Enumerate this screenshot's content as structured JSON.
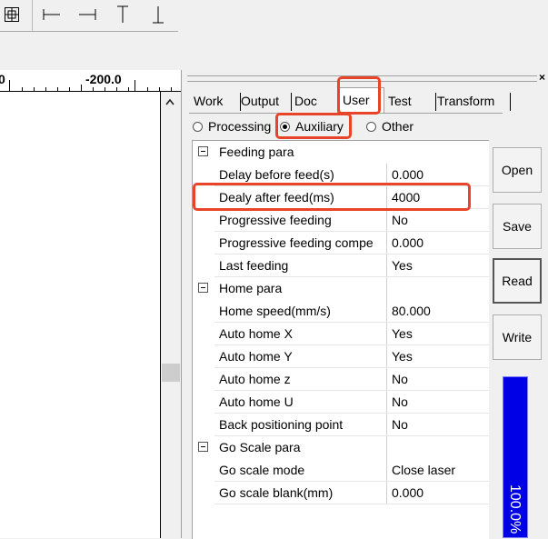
{
  "colors": {
    "highlight": "#e8442a",
    "gauge": "#0000e6",
    "window_bg": "#f0f0f0"
  },
  "toolbar": {
    "items": [
      {
        "icon": "grid-align-icon"
      },
      {
        "icon": "align-left-icon"
      },
      {
        "icon": "align-right-icon"
      },
      {
        "icon": "align-top-icon"
      },
      {
        "icon": "align-bottom-icon"
      }
    ]
  },
  "ruler": {
    "left_label": "0",
    "mid_label": "-200.0"
  },
  "tabs": [
    {
      "label": "Work"
    },
    {
      "label": "Output"
    },
    {
      "label": "Doc"
    },
    {
      "label": "User",
      "active": true
    },
    {
      "label": "Test"
    },
    {
      "label": "Transform"
    }
  ],
  "radios": [
    {
      "label": "Processing",
      "checked": false
    },
    {
      "label": "Auxiliary",
      "checked": true
    },
    {
      "label": "Other",
      "checked": false
    }
  ],
  "grid": {
    "rows": [
      {
        "type": "category",
        "name": "Feeding para",
        "value": ""
      },
      {
        "type": "item",
        "name": "Delay before feed(s)",
        "value": "0.000"
      },
      {
        "type": "item",
        "name": "Dealy after feed(ms)",
        "value": "4000"
      },
      {
        "type": "item",
        "name": "Progressive feeding",
        "value": "No"
      },
      {
        "type": "item",
        "name": "Progressive feeding compe",
        "value": "0.000"
      },
      {
        "type": "item",
        "name": "Last feeding",
        "value": "Yes"
      },
      {
        "type": "category",
        "name": "Home para",
        "value": ""
      },
      {
        "type": "item",
        "name": "Home speed(mm/s)",
        "value": "80.000"
      },
      {
        "type": "item",
        "name": "Auto home X",
        "value": "Yes"
      },
      {
        "type": "item",
        "name": "Auto home Y",
        "value": "Yes"
      },
      {
        "type": "item",
        "name": "Auto home z",
        "value": "No"
      },
      {
        "type": "item",
        "name": "Auto home U",
        "value": "No"
      },
      {
        "type": "item",
        "name": "Back positioning point",
        "value": "No"
      },
      {
        "type": "category",
        "name": "Go Scale para",
        "value": ""
      },
      {
        "type": "item",
        "name": "Go scale mode",
        "value": "Close laser"
      },
      {
        "type": "item",
        "name": "Go scale blank(mm)",
        "value": "0.000"
      }
    ]
  },
  "buttons": {
    "open": "Open",
    "save": "Save",
    "read": "Read",
    "write": "Write"
  },
  "progress": {
    "text": "100.0%",
    "percent": 100
  },
  "panel": {
    "close_glyph": "×"
  }
}
